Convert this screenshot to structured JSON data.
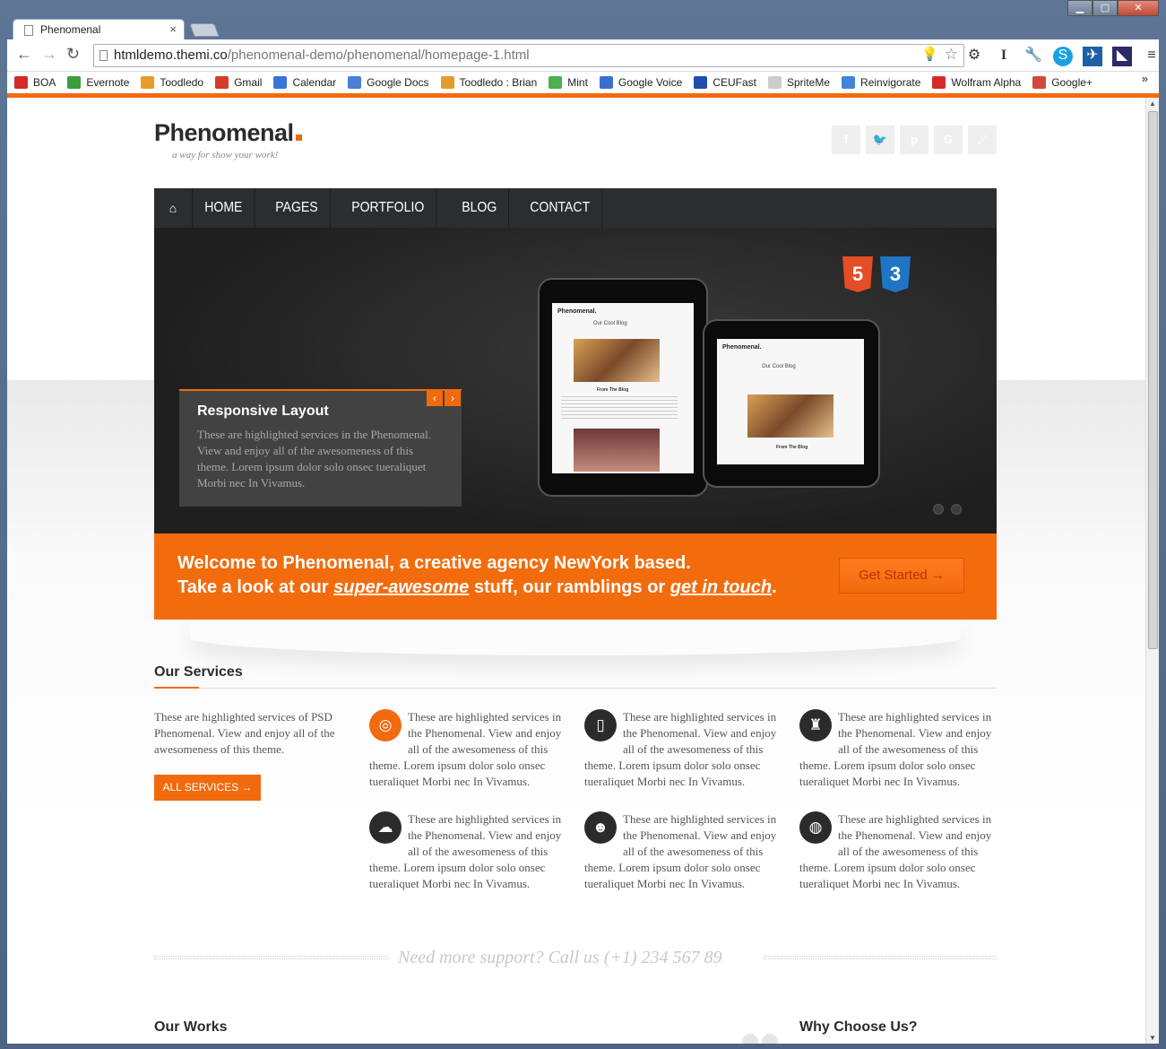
{
  "browser": {
    "tab_title": "Phenomenal",
    "url_host": "htmldemo.themi.co",
    "url_path": "/phenomenal-demo/phenomenal/homepage-1.html",
    "bookmarks": [
      {
        "label": "BOA",
        "color": "#d32b2b"
      },
      {
        "label": "Evernote",
        "color": "#3b9e3b"
      },
      {
        "label": "Toodledo",
        "color": "#e79b2a"
      },
      {
        "label": "Gmail",
        "color": "#d33b2b"
      },
      {
        "label": "Calendar",
        "color": "#3a74d6"
      },
      {
        "label": "Google Docs",
        "color": "#4a7ed8"
      },
      {
        "label": "Toodledo : Brian",
        "color": "#e79b2a"
      },
      {
        "label": "Mint",
        "color": "#4caf50"
      },
      {
        "label": "Google Voice",
        "color": "#3a6fd0"
      },
      {
        "label": "CEUFast",
        "color": "#1f4ea8"
      },
      {
        "label": "SpriteMe",
        "color": "#cccccc"
      },
      {
        "label": "Reinvigorate",
        "color": "#3f86d8"
      },
      {
        "label": "Wolfram Alpha",
        "color": "#d62a2a"
      },
      {
        "label": "Google+",
        "color": "#d34836"
      }
    ]
  },
  "site": {
    "logo": "Phenomenal",
    "tagline": "a way for show your work!",
    "social": [
      "f",
      "t",
      "p",
      "G",
      "rss"
    ],
    "menu": [
      "HOME",
      "PAGES",
      "PORTFOLIO",
      "BLOG",
      "CONTACT"
    ],
    "slider": {
      "caption_title": "Responsive Layout",
      "caption_text": "These are highlighted services in the Phenomenal. View and enjoy all of the awesomeness of this theme. Lorem ipsum dolor solo onsec tueraliquet Morbi nec In Vivamus.",
      "html5": "5",
      "css3": "3",
      "tablet_brand": "Phenomenal.",
      "tablet_blog": "Our Cool Blog",
      "tablet_from": "From The Blog"
    },
    "welcome": {
      "line1": "Welcome to Phenomenal, a creative agency NewYork based.",
      "line2_a": "Take a look at our ",
      "line2_link1": "super-awesome",
      "line2_b": " stuff, our ramblings or ",
      "line2_link2": "get in touch",
      "line2_c": ".",
      "button": "Get Started →"
    },
    "services": {
      "title": "Our Services",
      "intro": "These are highlighted services of PSD Phenomenal. View and enjoy all of the awesomeness of this theme.",
      "button": "ALL SERVICES →",
      "item_text": "These are highlighted services in the Phenomenal. View and enjoy all of the awesomeness of this theme. Lorem ipsum dolor solo onsec tueraliquet Morbi nec In Vivamus.",
      "icons": [
        "fingerprint-icon",
        "mobile-icon",
        "chess-rook-icon",
        "brain-icon",
        "users-icon",
        "globe-icon"
      ]
    },
    "support": "Need more support? Call us (+1) 234 567 89",
    "works_title": "Our Works",
    "why_title": "Why Choose Us?"
  }
}
